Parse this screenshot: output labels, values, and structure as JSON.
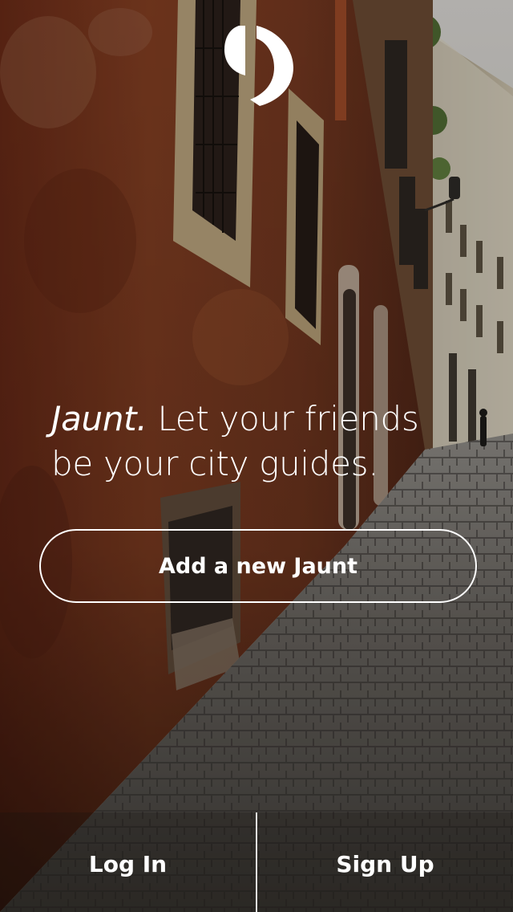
{
  "app": {
    "name": "Jaunt",
    "logo": "jaunt-apostrophe-logo"
  },
  "hero": {
    "brand": "Jaunt.",
    "tagline_rest": " Let your friends be your city guides."
  },
  "actions": {
    "add_label": "Add a new Jaunt",
    "login_label": "Log In",
    "signup_label": "Sign Up"
  },
  "colors": {
    "text": "#ffffff",
    "wall": "#7a3a22",
    "street": "#55524d"
  }
}
